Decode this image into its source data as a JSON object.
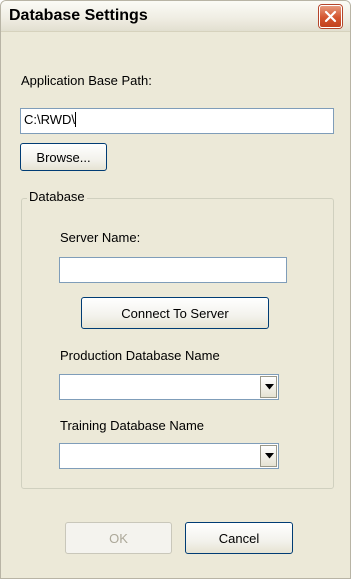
{
  "window": {
    "title": "Database Settings"
  },
  "app_path": {
    "label": "Application Base Path:",
    "value": "C:\\RWD\\",
    "browse_label": "Browse..."
  },
  "database_group": {
    "legend": "Database",
    "server_name_label": "Server Name:",
    "server_name_value": "",
    "connect_label": "Connect To Server",
    "production_label": "Production Database Name",
    "production_value": "",
    "training_label": "Training Database Name",
    "training_value": ""
  },
  "footer": {
    "ok_label": "OK",
    "cancel_label": "Cancel"
  },
  "icons": {
    "close": "close-icon",
    "dropdown": "chevron-down-icon"
  }
}
